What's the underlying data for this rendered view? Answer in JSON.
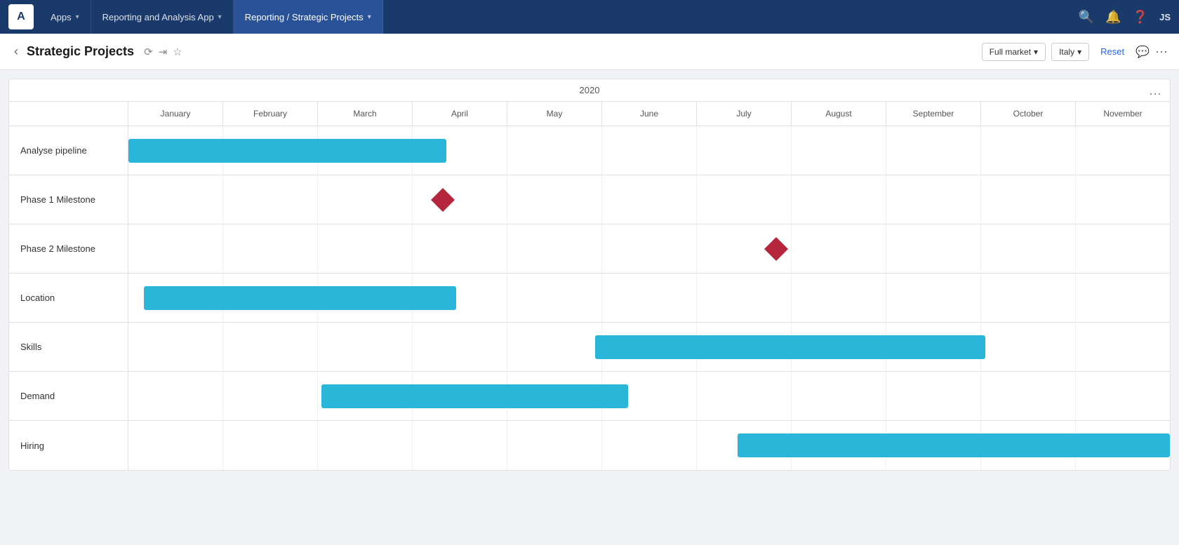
{
  "nav": {
    "logo": "A",
    "tabs": [
      {
        "label": "Apps",
        "chevron": true,
        "active": false
      },
      {
        "label": "Reporting and Analysis App",
        "chevron": true,
        "active": false
      },
      {
        "label": "Reporting / Strategic Projects",
        "chevron": true,
        "active": true
      }
    ],
    "right_icons": [
      "search",
      "bell",
      "help",
      "user"
    ],
    "user_initials": "JS"
  },
  "sub_nav": {
    "title": "Strategic Projects",
    "filters": [
      {
        "label": "Full market",
        "has_chevron": true
      },
      {
        "label": "Italy",
        "has_chevron": true
      }
    ],
    "reset_label": "Reset"
  },
  "gantt": {
    "year": "2020",
    "months": [
      "January",
      "February",
      "March",
      "April",
      "May",
      "June",
      "July",
      "August",
      "September",
      "October",
      "November"
    ],
    "rows": [
      {
        "label": "Analyse pipeline",
        "type": "bar",
        "start_month_pct": 0,
        "width_pct": 30.5
      },
      {
        "label": "Phase 1 Milestone",
        "type": "diamond",
        "position_pct": 30.2
      },
      {
        "label": "Phase 2 Milestone",
        "type": "diamond",
        "position_pct": 62.2
      },
      {
        "label": "Location",
        "type": "bar",
        "start_month_pct": 1.5,
        "width_pct": 30.0
      },
      {
        "label": "Skills",
        "type": "bar",
        "start_month_pct": 44.8,
        "width_pct": 37.5
      },
      {
        "label": "Demand",
        "type": "bar",
        "start_month_pct": 18.5,
        "width_pct": 29.5
      },
      {
        "label": "Hiring",
        "type": "bar",
        "start_month_pct": 58.5,
        "width_pct": 41.5
      }
    ]
  }
}
